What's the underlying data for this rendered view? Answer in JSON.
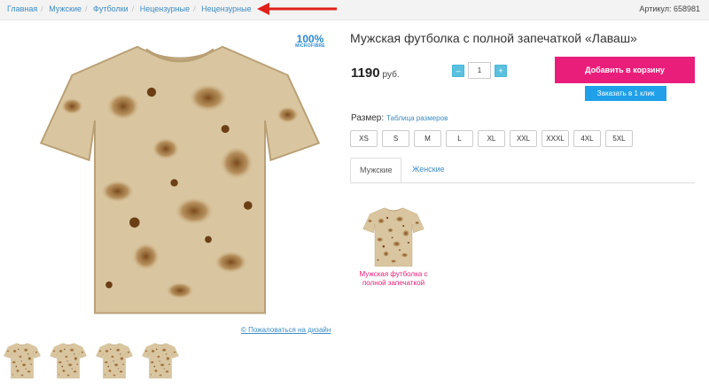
{
  "breadcrumbs": [
    "Главная",
    "Мужские",
    "Футболки",
    "Нецензурные",
    "Нецензурные"
  ],
  "article": "Артикул: 658981",
  "badge": {
    "line1": "100%",
    "line2": "MICROFIBRE"
  },
  "product": {
    "title": "Мужская футболка с полной запечаткой «Лаваш»",
    "price": "1190",
    "currency": "руб.",
    "quantity": "1"
  },
  "buttons": {
    "minus": "–",
    "plus": "+",
    "add_to_cart": "Добавить в корзину",
    "one_click": "Заказать в 1 клик",
    "complain": "© Пожаловаться на дизайн"
  },
  "size": {
    "label": "Размер:",
    "table_link": "Таблица размеров",
    "options": [
      "XS",
      "S",
      "M",
      "L",
      "XL",
      "XXL",
      "XXXL",
      "4XL",
      "5XL"
    ]
  },
  "tabs": [
    "Мужские",
    "Женские"
  ],
  "related": {
    "name": "Мужская футболка с полной запечаткой"
  },
  "colors": {
    "accent_pink": "#e91e7a",
    "accent_blue": "#1fa0e8",
    "link": "#3d8cc4"
  }
}
